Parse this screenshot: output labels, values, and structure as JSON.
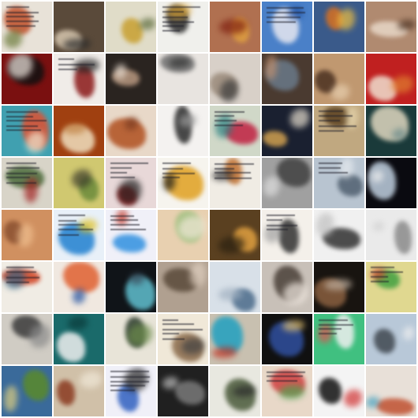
{
  "grid": {
    "rows": 8,
    "cols": 8,
    "tiles": [
      {
        "bg": "#e8e2d8",
        "a": "#c0502a",
        "b": "#6b7a3a",
        "text": true
      },
      {
        "bg": "#5a4a3a",
        "a": "#d8c8b0",
        "b": "#2a2a2a",
        "text": false
      },
      {
        "bg": "#e0dcc8",
        "a": "#c8a030",
        "b": "#5a6a3a",
        "text": false
      },
      {
        "bg": "#f0f0ec",
        "a": "#2a2a2a",
        "b": "#d8a030",
        "text": true
      },
      {
        "bg": "#b07050",
        "a": "#e0a040",
        "b": "#802010",
        "text": false
      },
      {
        "bg": "#4a80c8",
        "a": "#e8e8f0",
        "b": "#2050a0",
        "text": true
      },
      {
        "bg": "#3a5a8a",
        "a": "#d87020",
        "b": "#f0c040",
        "text": false
      },
      {
        "bg": "#b08a70",
        "a": "#e8d8c8",
        "b": "#4a3020",
        "text": false
      },
      {
        "bg": "#7a1010",
        "a": "#101010",
        "b": "#f0e8e0",
        "text": false
      },
      {
        "bg": "#f0ece8",
        "a": "#8a1818",
        "b": "#202020",
        "text": true
      },
      {
        "bg": "#2a2420",
        "a": "#b89880",
        "b": "#e8dcd0",
        "text": false
      },
      {
        "bg": "#e8e4e0",
        "a": "#707070",
        "b": "#303030",
        "text": false
      },
      {
        "bg": "#d8d0c8",
        "a": "#9a8a7a",
        "b": "#3a3a3a",
        "text": false
      },
      {
        "bg": "#4a3a30",
        "a": "#6a7a8a",
        "b": "#c09070",
        "text": false
      },
      {
        "bg": "#c09870",
        "a": "#4a3020",
        "b": "#e8d0b0",
        "text": false
      },
      {
        "bg": "#c02020",
        "a": "#f0e0d0",
        "b": "#e08030",
        "text": false
      },
      {
        "bg": "#40a0b0",
        "a": "#e05030",
        "b": "#f0e8d0",
        "text": true
      },
      {
        "bg": "#a04010",
        "a": "#f0e0c0",
        "b": "#c08040",
        "text": false
      },
      {
        "bg": "#e8d8c8",
        "a": "#b05020",
        "b": "#7a3a20",
        "text": false
      },
      {
        "bg": "#f4f2f0",
        "a": "#2a2a2a",
        "b": "#9a9a9a",
        "text": false
      },
      {
        "bg": "#d0d8c8",
        "a": "#c02040",
        "b": "#2a8080",
        "text": true
      },
      {
        "bg": "#1a2030",
        "a": "#d0a050",
        "b": "#e8e0d0",
        "text": false
      },
      {
        "bg": "#c0a880",
        "a": "#5a4020",
        "b": "#e8d8b0",
        "text": true
      },
      {
        "bg": "#1a3a3a",
        "a": "#e0d8c0",
        "b": "#6a8a8a",
        "text": false
      },
      {
        "bg": "#d8d4c8",
        "a": "#4a6a3a",
        "b": "#a02020",
        "text": true
      },
      {
        "bg": "#d0c870",
        "a": "#6a8a3a",
        "b": "#3a3a2a",
        "text": false
      },
      {
        "bg": "#e8d8d8",
        "a": "#a01010",
        "b": "#202020",
        "text": true
      },
      {
        "bg": "#f6f4ee",
        "a": "#e0a020",
        "b": "#1a1a1a",
        "text": true
      },
      {
        "bg": "#f0ece4",
        "a": "#c07030",
        "b": "#303030",
        "text": true
      },
      {
        "bg": "#a0a0a0",
        "a": "#404040",
        "b": "#e0e0e0",
        "text": false
      },
      {
        "bg": "#b8c4d0",
        "a": "#506070",
        "b": "#e8ecf0",
        "text": true
      },
      {
        "bg": "#0a0a10",
        "a": "#c0d0e0",
        "b": "#f0f0f0",
        "text": false
      },
      {
        "bg": "#d09060",
        "a": "#8a5030",
        "b": "#f0c090",
        "text": false
      },
      {
        "bg": "#e8f0f8",
        "a": "#2080d0",
        "b": "#e0c020",
        "text": true
      },
      {
        "bg": "#f0f0f8",
        "a": "#3090e0",
        "b": "#c03020",
        "text": true
      },
      {
        "bg": "#e8d0b0",
        "a": "#a0c080",
        "b": "#f0e8d8",
        "text": false
      },
      {
        "bg": "#5a4020",
        "a": "#e0a040",
        "b": "#2a2010",
        "text": false
      },
      {
        "bg": "#f4f0ea",
        "a": "#303030",
        "b": "#a0a0a0",
        "text": true
      },
      {
        "bg": "#f0f0f0",
        "a": "#303030",
        "b": "#c0c0c0",
        "text": false
      },
      {
        "bg": "#eaeaea",
        "a": "#8a8a8a",
        "b": "#d0d0d0",
        "text": false
      },
      {
        "bg": "#f0ece4",
        "a": "#d04020",
        "b": "#306080",
        "text": true
      },
      {
        "bg": "#f0e8e0",
        "a": "#e06030",
        "b": "#2050a0",
        "text": false
      },
      {
        "bg": "#101418",
        "a": "#60c0d0",
        "b": "#3a4a5a",
        "text": false
      },
      {
        "bg": "#b0a090",
        "a": "#5a4a3a",
        "b": "#e0d0c0",
        "text": false
      },
      {
        "bg": "#d8e0e8",
        "a": "#4a6a8a",
        "b": "#a0b0c0",
        "text": false
      },
      {
        "bg": "#c8c0b8",
        "a": "#4a4038",
        "b": "#f0e8e0",
        "text": false
      },
      {
        "bg": "#181410",
        "a": "#8a6040",
        "b": "#c0b0a0",
        "text": false
      },
      {
        "bg": "#e0d890",
        "a": "#40a040",
        "b": "#d04030",
        "text": true
      },
      {
        "bg": "#d0ccc4",
        "a": "#3a3a3a",
        "b": "#8a8a8a",
        "text": false
      },
      {
        "bg": "#1a6a6a",
        "a": "#f0f0f0",
        "b": "#0a3a3a",
        "text": false
      },
      {
        "bg": "#e8e4d8",
        "a": "#2a3a2a",
        "b": "#6a8a4a",
        "text": false
      },
      {
        "bg": "#f0e8d8",
        "a": "#8a6a4a",
        "b": "#404040",
        "text": true
      },
      {
        "bg": "#c8c0b0",
        "a": "#20a0c0",
        "b": "#c03020",
        "text": false
      },
      {
        "bg": "#101010",
        "a": "#3050a0",
        "b": "#e0c070",
        "text": false
      },
      {
        "bg": "#40c080",
        "a": "#f0f0f0",
        "b": "#e05050",
        "text": true
      },
      {
        "bg": "#b8c8d8",
        "a": "#404850",
        "b": "#f0f0f0",
        "text": false
      },
      {
        "bg": "#3a6a9a",
        "a": "#5a8a2a",
        "b": "#e0d080",
        "text": false
      },
      {
        "bg": "#d0c0a8",
        "a": "#8a3a20",
        "b": "#f0e8d8",
        "text": false
      },
      {
        "bg": "#f0f0f8",
        "a": "#3060c0",
        "b": "#202020",
        "text": true
      },
      {
        "bg": "#202020",
        "a": "#7a7a7a",
        "b": "#c0c0c0",
        "text": false
      },
      {
        "bg": "#e8e8e0",
        "a": "#4a5a3a",
        "b": "#2a2a2a",
        "text": false
      },
      {
        "bg": "#e8d8c8",
        "a": "#d04040",
        "b": "#50a050",
        "text": true
      },
      {
        "bg": "#f4f4f4",
        "a": "#101010",
        "b": "#d03030",
        "text": false
      },
      {
        "bg": "#e8e0d8",
        "a": "#c05030",
        "b": "#40a0c0",
        "text": false
      }
    ]
  }
}
